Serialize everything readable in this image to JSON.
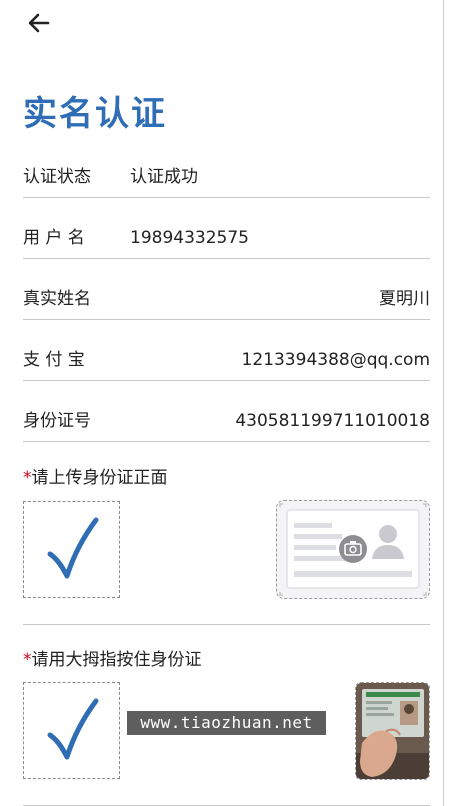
{
  "header": {
    "back_icon": "arrow-left-icon"
  },
  "page": {
    "title": "实名认证"
  },
  "fields": [
    {
      "label": "认证状态",
      "value": "认证成功"
    },
    {
      "label": "用 户 名",
      "value": "19894332575"
    },
    {
      "label": "真实姓名",
      "value": "夏明川"
    },
    {
      "label": "支 付 宝",
      "value": "1213394388@qq.com"
    },
    {
      "label": "身份证号",
      "value": "430581199711010018"
    }
  ],
  "upload_front": {
    "required_mark": "*",
    "title": "请上传身份证正面",
    "check_icon": "checkmark-icon",
    "sample_icon": "id-card-camera-icon"
  },
  "upload_thumb": {
    "required_mark": "*",
    "title": "请用大拇指按住身份证",
    "check_icon": "checkmark-icon",
    "sample_icon": "hand-holding-id-photo"
  },
  "watermark": {
    "text": "www.tiaozhuan.net"
  },
  "colors": {
    "accent": "#2f6db5",
    "required": "#d0021b",
    "divider": "#c8c8c8"
  }
}
